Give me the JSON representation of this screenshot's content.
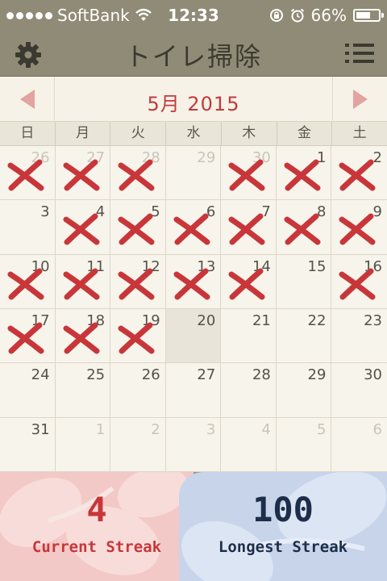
{
  "status_bar": {
    "carrier": "SoftBank",
    "time": "12:33",
    "battery": "66%",
    "battery_level": 0.66
  },
  "header": {
    "title": "トイレ掃除",
    "settings_icon": "gear-icon",
    "menu_icon": "list-icon"
  },
  "calendar": {
    "month_label": "5月 2015",
    "weekdays": [
      "日",
      "月",
      "火",
      "水",
      "木",
      "金",
      "土"
    ],
    "weeks": [
      [
        {
          "day": "26",
          "other": true,
          "done": true
        },
        {
          "day": "27",
          "other": true,
          "done": true
        },
        {
          "day": "28",
          "other": true,
          "done": true
        },
        {
          "day": "29",
          "other": true,
          "done": false
        },
        {
          "day": "30",
          "other": true,
          "done": true
        },
        {
          "day": "1",
          "other": false,
          "done": true
        },
        {
          "day": "2",
          "other": false,
          "done": true
        }
      ],
      [
        {
          "day": "3",
          "other": false,
          "done": false
        },
        {
          "day": "4",
          "other": false,
          "done": true
        },
        {
          "day": "5",
          "other": false,
          "done": true
        },
        {
          "day": "6",
          "other": false,
          "done": true
        },
        {
          "day": "7",
          "other": false,
          "done": true
        },
        {
          "day": "8",
          "other": false,
          "done": true
        },
        {
          "day": "9",
          "other": false,
          "done": true
        }
      ],
      [
        {
          "day": "10",
          "other": false,
          "done": true
        },
        {
          "day": "11",
          "other": false,
          "done": true
        },
        {
          "day": "12",
          "other": false,
          "done": true
        },
        {
          "day": "13",
          "other": false,
          "done": true
        },
        {
          "day": "14",
          "other": false,
          "done": true
        },
        {
          "day": "15",
          "other": false,
          "done": false
        },
        {
          "day": "16",
          "other": false,
          "done": true
        }
      ],
      [
        {
          "day": "17",
          "other": false,
          "done": true
        },
        {
          "day": "18",
          "other": false,
          "done": true
        },
        {
          "day": "19",
          "other": false,
          "done": true
        },
        {
          "day": "20",
          "other": false,
          "done": false,
          "today": true
        },
        {
          "day": "21",
          "other": false,
          "done": false
        },
        {
          "day": "22",
          "other": false,
          "done": false
        },
        {
          "day": "23",
          "other": false,
          "done": false
        }
      ],
      [
        {
          "day": "24",
          "other": false,
          "done": false
        },
        {
          "day": "25",
          "other": false,
          "done": false
        },
        {
          "day": "26",
          "other": false,
          "done": false
        },
        {
          "day": "27",
          "other": false,
          "done": false
        },
        {
          "day": "28",
          "other": false,
          "done": false
        },
        {
          "day": "29",
          "other": false,
          "done": false
        },
        {
          "day": "30",
          "other": false,
          "done": false
        }
      ],
      [
        {
          "day": "31",
          "other": false,
          "done": false
        },
        {
          "day": "1",
          "other": true,
          "done": false
        },
        {
          "day": "2",
          "other": true,
          "done": false
        },
        {
          "day": "3",
          "other": true,
          "done": false
        },
        {
          "day": "4",
          "other": true,
          "done": false
        },
        {
          "day": "5",
          "other": true,
          "done": false
        },
        {
          "day": "6",
          "other": true,
          "done": false
        }
      ]
    ]
  },
  "streaks": {
    "current_value": "4",
    "current_label": "Current Streak",
    "longest_value": "100",
    "longest_label": "Longest Streak"
  },
  "colors": {
    "header_bg": "#8f8b76",
    "accent_red": "#c8363a",
    "streak_navy": "#1e2e4a"
  }
}
